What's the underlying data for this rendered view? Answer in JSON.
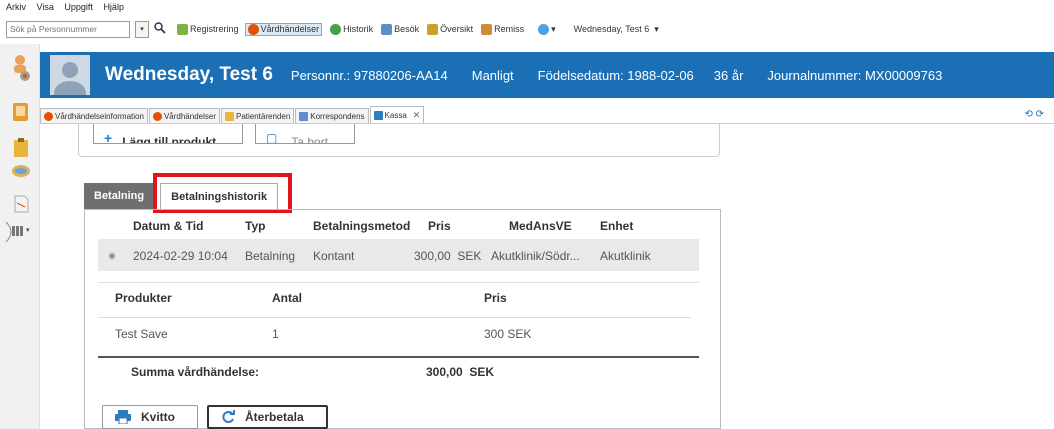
{
  "menu": [
    "Arkiv",
    "Visa",
    "Uppgift",
    "Hjälp"
  ],
  "toolbar": {
    "search_placeholder": "Sök på Personnummer",
    "items": [
      {
        "label": "Registrering",
        "icon": "pencil-icon",
        "color": "#7cb342"
      },
      {
        "label": "Vårdhändelser",
        "icon": "vardhandelse-icon",
        "color": "#e65100"
      },
      {
        "label": "Historik",
        "icon": "history-icon",
        "color": "#43a047"
      },
      {
        "label": "Besök",
        "icon": "visit-icon",
        "color": "#5c8ec9"
      },
      {
        "label": "Översikt",
        "icon": "overview-icon",
        "color": "#c9a227"
      },
      {
        "label": "Remiss",
        "icon": "referral-icon",
        "color": "#d08b3a"
      }
    ],
    "patient_select": "Wednesday, Test 6"
  },
  "header": {
    "name": "Wednesday, Test 6",
    "personnr": "Personnr.: 97880206-AA14",
    "gender": "Manligt",
    "birth": "Födelsedatum: 1988-02-06",
    "age": "36 år",
    "journal": "Journalnummer: MX00009763",
    "bg": "#1a6fb5"
  },
  "doc_tabs": [
    "Vårdhändelseinformation",
    "Vårdhändelser",
    "Patientärenden",
    "Korrespondens",
    "Kassa"
  ],
  "upper_buttons": {
    "add": "Lägg till produkt",
    "remove": "Ta bort"
  },
  "tabs": {
    "betalning": "Betalning",
    "historik": "Betalningshistorik"
  },
  "table": {
    "headers": [
      "Datum & Tid",
      "Typ",
      "Betalningsmetod",
      "Pris",
      "MedAnsVE",
      "Enhet"
    ],
    "row": [
      "2024-02-29 10:04",
      "Betalning",
      "Kontant",
      "300,00  SEK",
      "Akutklinik/Södr...",
      "Akutklinik"
    ]
  },
  "products": {
    "headers": [
      "Produkter",
      "Antal",
      "Pris"
    ],
    "row": [
      "Test Save",
      "1",
      "300 SEK"
    ]
  },
  "summary": {
    "label": "Summa vårdhändelse:",
    "value": "300,00  SEK"
  },
  "actions": {
    "kvitto": "Kvitto",
    "aterbetala": "Återbetala"
  },
  "highlight_color": "#e0141d"
}
